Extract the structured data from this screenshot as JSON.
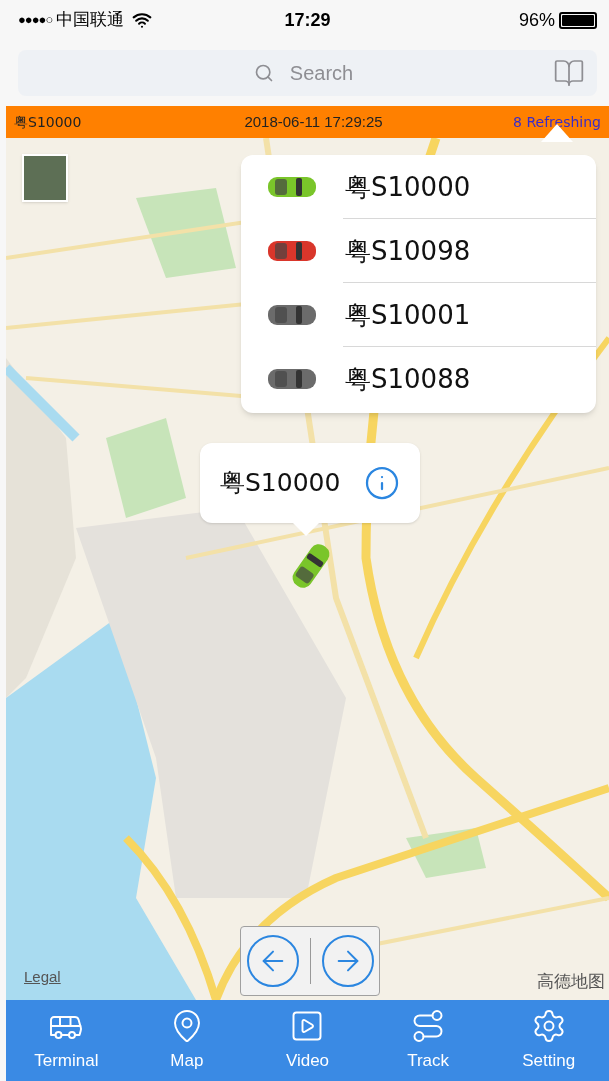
{
  "status_bar": {
    "signal": "●●●●○",
    "carrier": "中国联通",
    "time": "17:29",
    "battery": "96%"
  },
  "search": {
    "placeholder": "Search"
  },
  "info_bar": {
    "plate": "粤S10000",
    "datetime": "2018-06-11 17:29:25",
    "refresh": "8 Refreshing"
  },
  "vehicles": [
    {
      "plate": "粤S10000",
      "color": "#7ac52a"
    },
    {
      "plate": "粤S10098",
      "color": "#d9362b"
    },
    {
      "plate": "粤S10001",
      "color": "#6b6b6b"
    },
    {
      "plate": "粤S10088",
      "color": "#6b6b6b"
    }
  ],
  "callout": {
    "plate": "粤S10000",
    "color": "#7ac52a"
  },
  "map": {
    "legal": "Legal",
    "provider": "高德地图"
  },
  "tabs": [
    {
      "label": "Terminal",
      "kind": "bus"
    },
    {
      "label": "Map",
      "kind": "pin"
    },
    {
      "label": "Video",
      "kind": "play"
    },
    {
      "label": "Track",
      "kind": "route"
    },
    {
      "label": "Setting",
      "kind": "gear"
    }
  ]
}
